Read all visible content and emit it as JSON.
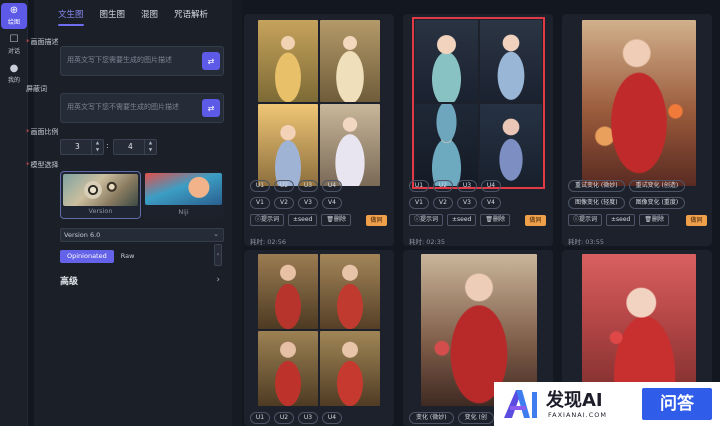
{
  "rail": [
    {
      "label": "绘图",
      "icon": "plus-icon",
      "active": true
    },
    {
      "label": "对话",
      "icon": "chat-icon",
      "active": false
    },
    {
      "label": "我的",
      "icon": "user-icon",
      "active": false
    }
  ],
  "tabs": [
    "文生图",
    "图生图",
    "混图",
    "咒语解析"
  ],
  "form": {
    "prompt_label": "画面描述",
    "prompt_placeholder": "用英文写下您需要生成的图片描述",
    "negative_label": "屏蔽词",
    "negative_placeholder": "用英文写下您不需要生成的图片描述",
    "ratio_label": "画面比例",
    "ratio_w": "3",
    "ratio_h": "4",
    "ratio_sep": ":",
    "model_label": "模型选择",
    "models": [
      "Version",
      "Niji"
    ],
    "version_value": "Version 6.0",
    "styles": [
      "Opinionated",
      "Raw"
    ],
    "advanced_label": "高级"
  },
  "cards": [
    {
      "upscale": [
        "U1",
        "U2",
        "U3",
        "U4"
      ],
      "variation": [
        "V1",
        "V2",
        "V3",
        "V4"
      ],
      "actions": [
        "ⓘ提示词",
        "±seed",
        "🗑删除"
      ],
      "badge": "做同",
      "time": "耗时: 02:56"
    },
    {
      "upscale": [
        "U1",
        "U2",
        "U3",
        "U4"
      ],
      "variation": [
        "V1",
        "V2",
        "V3",
        "V4"
      ],
      "actions": [
        "ⓘ提示词",
        "±seed",
        "🗑删除"
      ],
      "badge": "做同",
      "time": "耗时: 02:35"
    },
    {
      "row1": [
        "重试变化 (微妙)",
        "重试变化 (创造)"
      ],
      "row2": [
        "图像变化 (轻度)",
        "图像变化 (重度)"
      ],
      "actions": [
        "ⓘ提示词",
        "±seed",
        "🗑删除"
      ],
      "badge": "做同",
      "time": "耗时: 03:55"
    },
    {
      "upscale": [
        "U1",
        "U2",
        "U3",
        "U4"
      ]
    },
    {
      "row1": [
        "变化 (微妙)",
        "变化 (创"
      ]
    }
  ],
  "ad": {
    "title": "发现AI",
    "subtitle": "FAXIANAI.COM",
    "button": "问答"
  }
}
